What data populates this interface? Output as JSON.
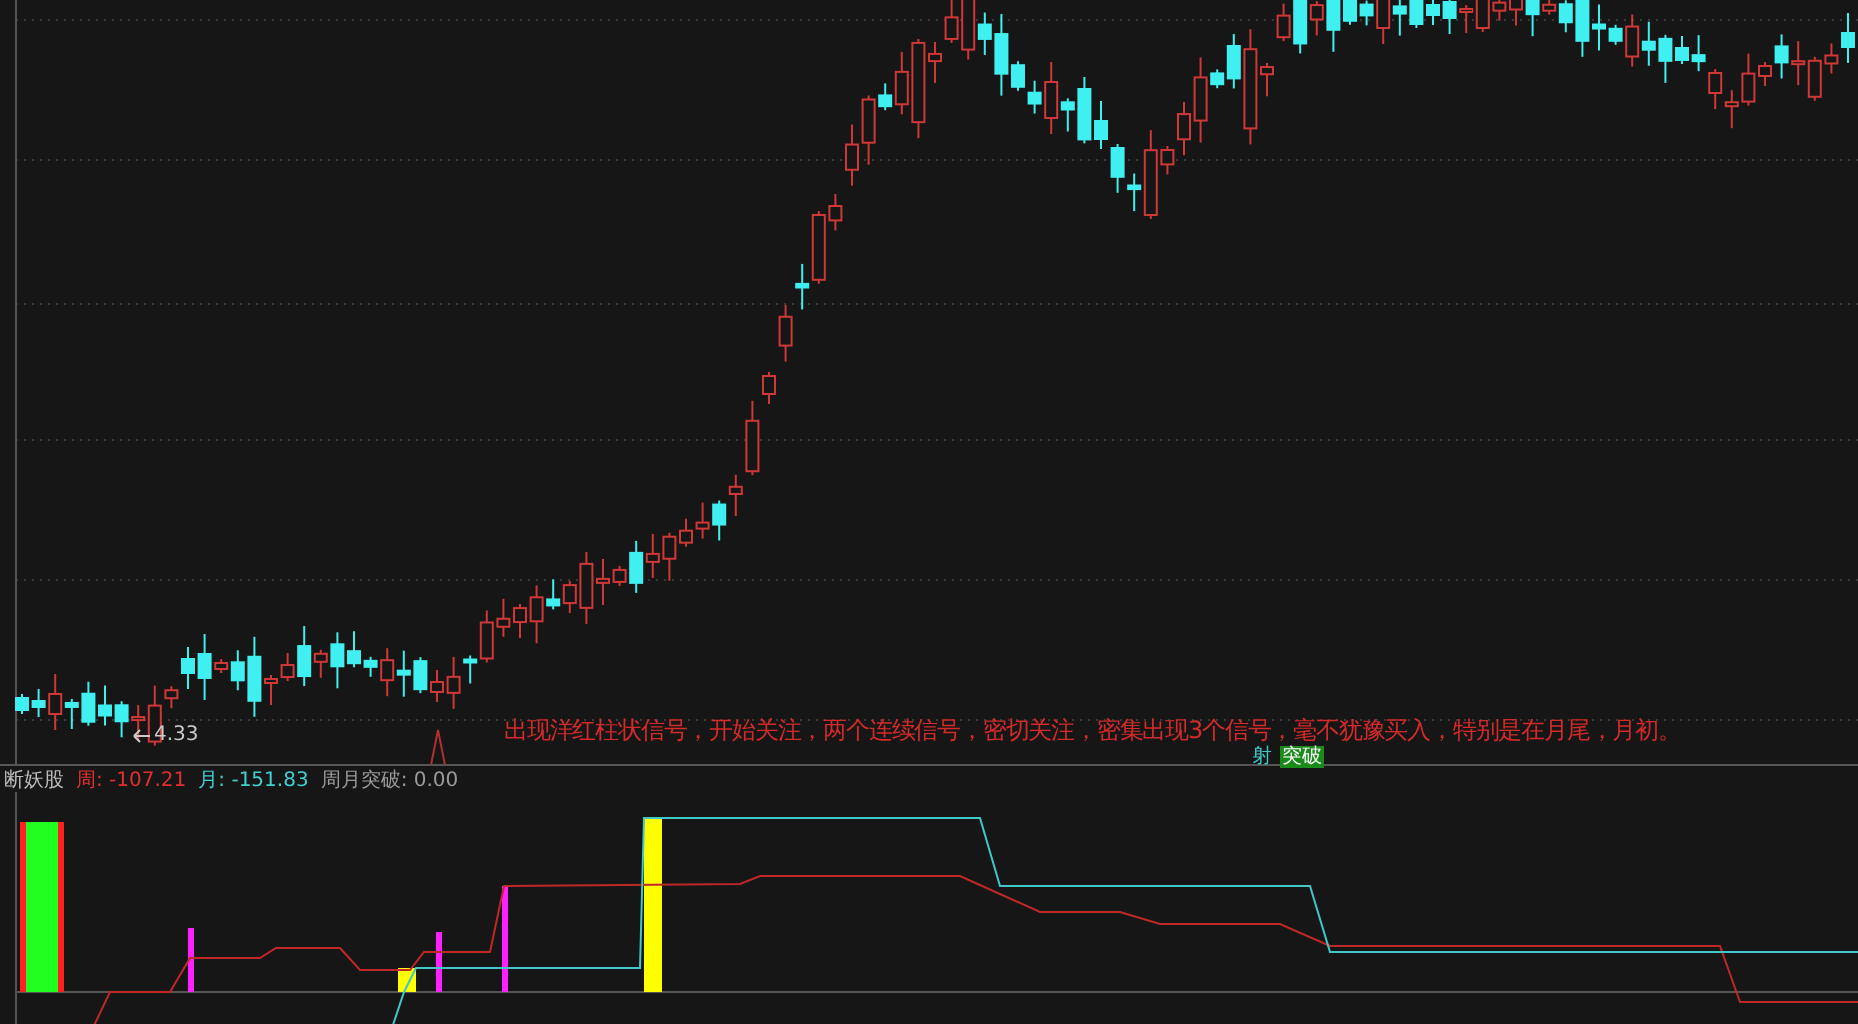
{
  "main_chart": {
    "low_label": "4.33",
    "annotation": "出现洋红柱状信号，开始关注，两个连续信号，密切关注，密集出现3个信号，毫不犹豫买入，特别是在月尾，月初。",
    "markers": [
      {
        "text": "射",
        "kind": "plain"
      },
      {
        "text": "突破",
        "kind": "tag"
      }
    ]
  },
  "indicator": {
    "name": "断妖股",
    "readings": [
      {
        "label": "周:",
        "value": "-107.21",
        "color": "#e03030"
      },
      {
        "label": "月:",
        "value": "-151.83",
        "color": "#40d0d0"
      },
      {
        "label": "周月突破:",
        "value": "0.00",
        "color": "#9a9a9a"
      }
    ]
  }
}
